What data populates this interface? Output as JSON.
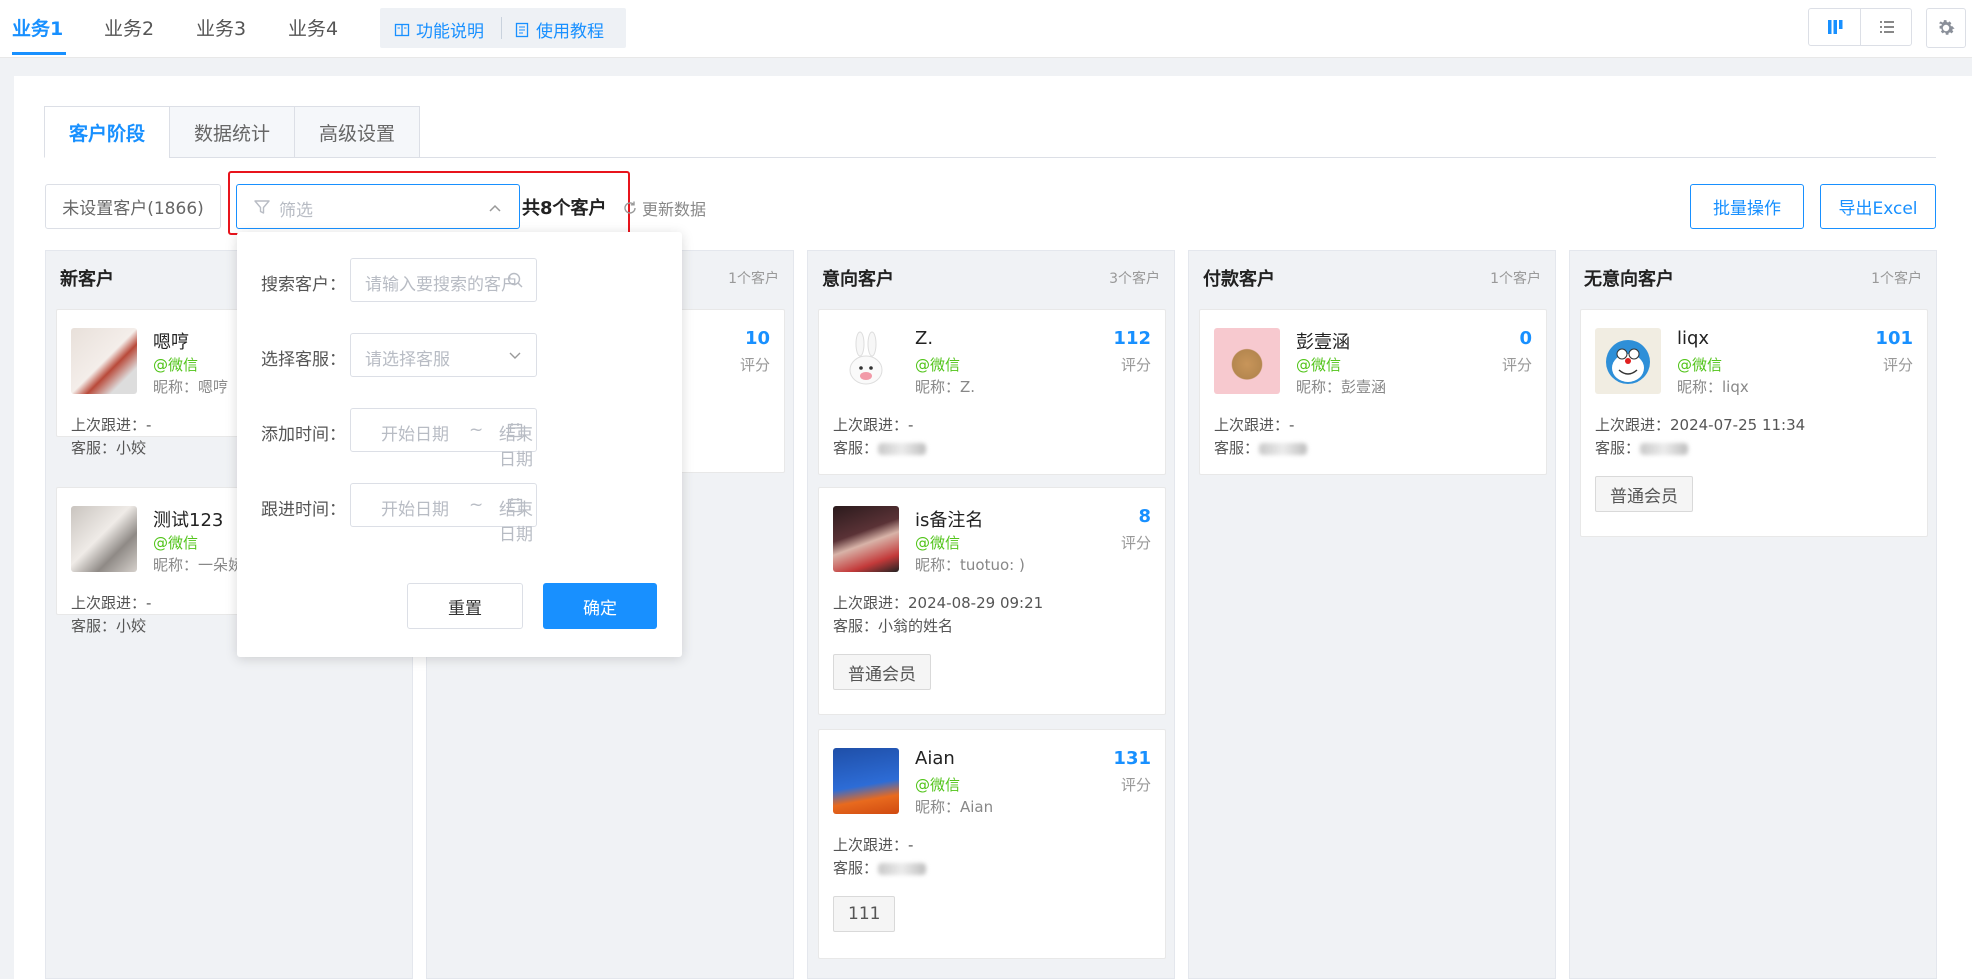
{
  "top_tabs": [
    "业务1",
    "业务2",
    "业务3",
    "业务4"
  ],
  "help": {
    "feature_desc": "功能说明",
    "tutorial": "使用教程"
  },
  "page_tabs": [
    "客户阶段",
    "数据统计",
    "高级设置"
  ],
  "toolbar": {
    "unset_customers": "未设置客户(1866)",
    "filter_placeholder": "筛选",
    "total": "共8个客户",
    "refresh": "更新数据",
    "batch": "批量操作",
    "export": "导出Excel"
  },
  "filter_popup": {
    "search_label": "搜索客户：",
    "search_placeholder": "请输入要搜索的客户",
    "agent_label": "选择客服：",
    "agent_placeholder": "请选择客服",
    "added_label": "添加时间：",
    "follow_label": "跟进时间：",
    "start_date": "开始日期",
    "tilde": "~",
    "end_date": "结束日期",
    "reset": "重置",
    "confirm": "确定"
  },
  "columns": [
    {
      "title": "新客户",
      "count": "",
      "cards": [
        {
          "name": "嗯哼",
          "channel": "@微信",
          "nickname": "昵称：嗯哼",
          "follow": "上次跟进：-",
          "agent": "客服：小姣"
        },
        {
          "name": "测试123",
          "channel": "@微信",
          "nickname": "昵称：一朵娇",
          "follow": "上次跟进：-",
          "agent": "客服：小姣"
        }
      ]
    },
    {
      "title": "",
      "count": "1个客户",
      "cards": [
        {
          "score": "10",
          "score_label": "评分"
        }
      ]
    },
    {
      "title": "意向客户",
      "count": "3个客户",
      "cards": [
        {
          "name": "Z.",
          "channel": "@微信",
          "nickname": "昵称：Z.",
          "score": "112",
          "score_label": "评分",
          "follow": "上次跟进：-",
          "agent": "客服：",
          "tag": ""
        },
        {
          "name": "is备注名",
          "channel": "@微信",
          "nickname": "昵称：tuotuo: )",
          "score": "8",
          "score_label": "评分",
          "follow": "上次跟进：2024-08-29 09:21",
          "agent": "客服：小翁的姓名",
          "tag": "普通会员"
        },
        {
          "name": "Aian",
          "channel": "@微信",
          "nickname": "昵称：Aian",
          "score": "131",
          "score_label": "评分",
          "follow": "上次跟进：-",
          "agent": "客服：",
          "tag": "111"
        }
      ]
    },
    {
      "title": "付款客户",
      "count": "1个客户",
      "cards": [
        {
          "name": "彭壹涵",
          "channel": "@微信",
          "nickname": "昵称：彭壹涵",
          "score": "0",
          "score_label": "评分",
          "follow": "上次跟进：-",
          "agent": "客服："
        }
      ]
    },
    {
      "title": "无意向客户",
      "count": "1个客户",
      "cards": [
        {
          "name": "liqx",
          "channel": "@微信",
          "nickname": "昵称：liqx",
          "score": "101",
          "score_label": "评分",
          "follow": "上次跟进：2024-07-25 11:34",
          "agent": "客服：",
          "tag": "普通会员"
        }
      ]
    }
  ],
  "colors": {
    "primary": "#1890ff",
    "wechat": "#52c41a",
    "highlight": "#e8141c"
  }
}
